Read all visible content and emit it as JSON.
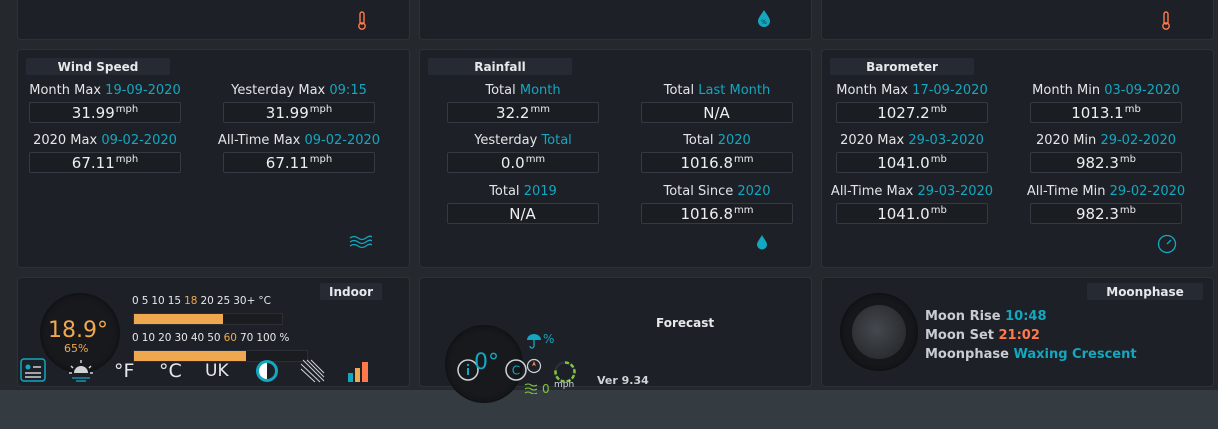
{
  "wind": {
    "title": "Wind Speed",
    "cells": [
      {
        "label": "Month Max",
        "accent": "19-09-2020",
        "value": "31.99",
        "unit": "mph"
      },
      {
        "label": "Yesterday Max",
        "accent": "09:15",
        "value": "31.99",
        "unit": "mph"
      },
      {
        "label": "2020 Max",
        "accent": "09-02-2020",
        "value": "67.11",
        "unit": "mph"
      },
      {
        "label": "All-Time Max",
        "accent": "09-02-2020",
        "value": "67.11",
        "unit": "mph"
      }
    ],
    "icon": "wind-waves-icon"
  },
  "rainfall": {
    "title": "Rainfall",
    "cells": [
      {
        "label": "Total",
        "accent": "Month",
        "value": "32.2",
        "unit": "mm"
      },
      {
        "label": "Total",
        "accent": "Last Month",
        "value": "N/A",
        "unit": ""
      },
      {
        "label": "Yesterday",
        "accent": "Total",
        "value": "0.0",
        "unit": "mm"
      },
      {
        "label": "Total",
        "accent": "2020",
        "value": "1016.8",
        "unit": "mm"
      },
      {
        "label": "Total",
        "accent": "2019",
        "value": "N/A",
        "unit": ""
      },
      {
        "label": "Total Since",
        "accent": "2020",
        "value": "1016.8",
        "unit": "mm"
      }
    ],
    "icon": "raindrop-icon"
  },
  "barometer": {
    "title": "Barometer",
    "cells": [
      {
        "label": "Month Max",
        "accent": "17-09-2020",
        "value": "1027.2",
        "unit": "mb"
      },
      {
        "label": "Month Min",
        "accent": "03-09-2020",
        "value": "1013.1",
        "unit": "mb"
      },
      {
        "label": "2020 Max",
        "accent": "29-03-2020",
        "value": "1041.0",
        "unit": "mb"
      },
      {
        "label": "2020 Min",
        "accent": "29-02-2020",
        "value": "982.3",
        "unit": "mb"
      },
      {
        "label": "All-Time Max",
        "accent": "29-03-2020",
        "value": "1041.0",
        "unit": "mb"
      },
      {
        "label": "All-Time Min",
        "accent": "29-02-2020",
        "value": "982.3",
        "unit": "mb"
      }
    ],
    "icon": "gauge-icon"
  },
  "indoor": {
    "title": "Indoor",
    "temp": "18.9°",
    "humidity": "65%",
    "temp_scale": [
      "0",
      "5",
      "10",
      "15",
      "18",
      "20",
      "25",
      "30+",
      "°C"
    ],
    "temp_scale_highlight": "18",
    "temp_level": 0.6,
    "hum_scale": [
      "0",
      "10",
      "20",
      "30",
      "40",
      "50",
      "60",
      "70",
      "100",
      "%"
    ],
    "hum_scale_highlight": "60",
    "hum_level": 0.65
  },
  "toolbar": {
    "unit_f": "°F",
    "unit_c": "°C",
    "unit_uk": "UK"
  },
  "forecast": {
    "title": "Forecast",
    "temp": "0°",
    "rain_pct": "%",
    "wind_value": "0",
    "wind_unit": "mph",
    "version": "Ver 9.34"
  },
  "moon": {
    "title": "Moonphase",
    "rise_label": "Moon Rise",
    "rise_value": "10:48",
    "set_label": "Moon Set",
    "set_value": "21:02",
    "phase_label": "Moonphase",
    "phase_value": "Waxing Crescent"
  },
  "colors": {
    "accent": "#13a7c0",
    "orange": "#f0a850",
    "red": "#ff7a4a"
  }
}
